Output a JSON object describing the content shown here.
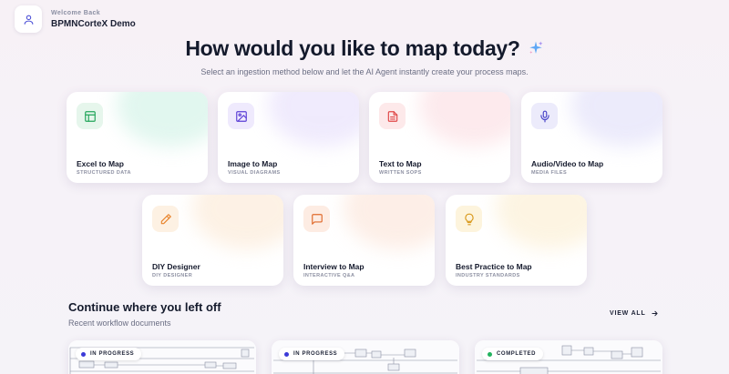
{
  "header": {
    "welcome_label": "Welcome Back",
    "user_name": "BPMNCorteX Demo",
    "avatar_icon": "user-icon"
  },
  "hero": {
    "title": "How would you like to map today?",
    "subtitle": "Select an ingestion method below and let the AI Agent instantly create your process maps.",
    "sparkle_icon": "sparkle-icon"
  },
  "cards": [
    {
      "title": "Excel to Map",
      "subtitle": "STRUCTURED DATA",
      "icon": "table-icon",
      "accent": "#22a55a",
      "tint": "#e6f6ec",
      "glow": "#c9f0e2"
    },
    {
      "title": "Image to Map",
      "subtitle": "VISUAL DIAGRAMS",
      "icon": "image-icon",
      "accent": "#5b3fd6",
      "tint": "#efeafd",
      "glow": "#e3dafb"
    },
    {
      "title": "Text to Map",
      "subtitle": "WRITTEN SOPS",
      "icon": "document-icon",
      "accent": "#e04848",
      "tint": "#fde9ea",
      "glow": "#fbd9de"
    },
    {
      "title": "Audio/Video to Map",
      "subtitle": "MEDIA FILES",
      "icon": "microphone-icon",
      "accent": "#4a45c9",
      "tint": "#ecebfb",
      "glow": "#dcdaf8"
    },
    {
      "title": "DIY Designer",
      "subtitle": "DIY DESIGNER",
      "icon": "pencil-icon",
      "accent": "#e8842c",
      "tint": "#fdf1e3",
      "glow": "#fbe6cf"
    },
    {
      "title": "Interview to Map",
      "subtitle": "INTERACTIVE Q&A",
      "icon": "chat-icon",
      "accent": "#e06a2c",
      "tint": "#fdece3",
      "glow": "#fbe1d3"
    },
    {
      "title": "Best Practice to Map",
      "subtitle": "INDUSTRY STANDARDS",
      "icon": "lightbulb-icon",
      "accent": "#d99a1e",
      "tint": "#fdf4dd",
      "glow": "#fbeccb"
    }
  ],
  "recent": {
    "title": "Continue where you left off",
    "subtitle": "Recent workflow documents",
    "view_all_label": "VIEW ALL",
    "docs": [
      {
        "status": "IN PROGRESS",
        "status_color": "#3b3ad8"
      },
      {
        "status": "IN PROGRESS",
        "status_color": "#3b3ad8"
      },
      {
        "status": "COMPLETED",
        "status_color": "#22b35e"
      }
    ]
  }
}
